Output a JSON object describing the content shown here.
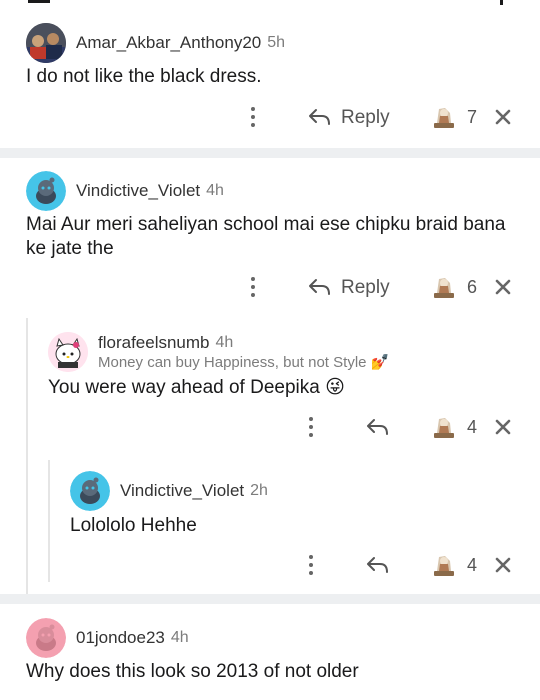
{
  "comments": [
    {
      "username": "Amar_Akbar_Anthony20",
      "age": "5h",
      "text": "I do not like the black dress.",
      "reply_label": "Reply",
      "votes": "7"
    },
    {
      "username": "Vindictive_Violet",
      "age": "4h",
      "text": "Mai Aur meri saheliyan school mai ese chipku braid bana ke jate the",
      "reply_label": "Reply",
      "votes": "6"
    },
    {
      "username": "florafeelsnumb",
      "age": "4h",
      "flair": "Money can buy Happiness, but not Style 💅",
      "text": "You were way ahead of Deepika 😜",
      "votes": "4"
    },
    {
      "username": "Vindictive_Violet",
      "age": "2h",
      "text": "Lolololo Hehhe",
      "votes": "4"
    },
    {
      "username": "01jondoe23",
      "age": "4h",
      "text": "Why does this look so 2013 of not older"
    }
  ],
  "colors": {
    "separator": "#edeff1",
    "snoo_cyan": "#45c4e8",
    "snoo_pink": "#f4a0b0",
    "text": "#1a1a1b",
    "meta": "#7c7c7c"
  },
  "icons": [
    "more-options-icon",
    "reply-arrow-icon",
    "award-icon",
    "close-icon",
    "snoo-avatar-icon"
  ]
}
